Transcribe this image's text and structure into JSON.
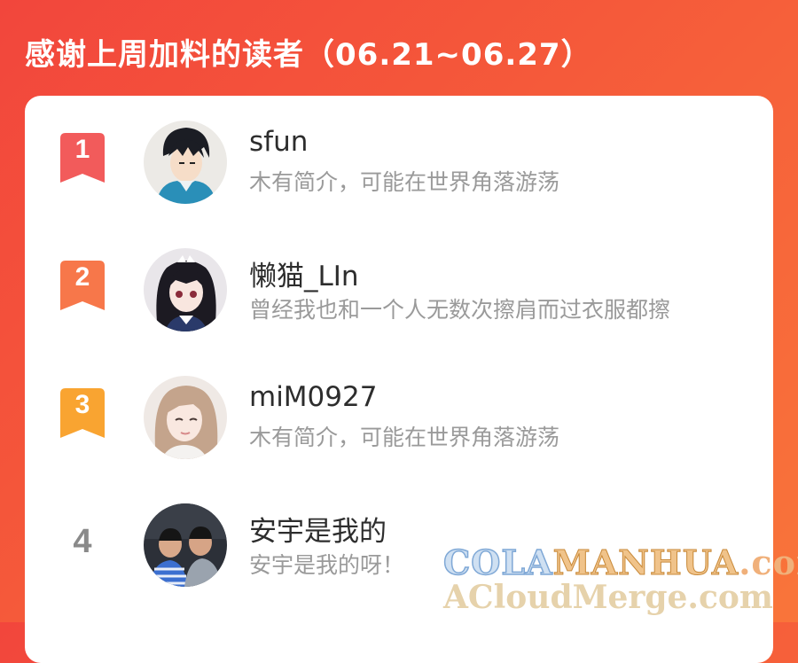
{
  "header": {
    "title": "感谢上周加料的读者（06.21~06.27）"
  },
  "readers": [
    {
      "rank": "1",
      "name": "sfun",
      "bio": "木有简介，可能在世界角落游荡",
      "badge_color": "#f25b5b"
    },
    {
      "rank": "2",
      "name": "懒猫_LIn",
      "bio": "曾经我也和一个人无数次擦肩而过衣服都擦",
      "badge_color": "#f7774a"
    },
    {
      "rank": "3",
      "name": "miM0927",
      "bio": "木有简介，可能在世界角落游荡",
      "badge_color": "#f9a431"
    },
    {
      "rank": "4",
      "name": "安宇是我的",
      "bio": "安宇是我的呀！"
    }
  ],
  "watermark": {
    "part1": "COLA",
    "part2": "MANHUA",
    "part3": ".com",
    "line2": "ACloudMerge.com"
  },
  "colors": {
    "background_start": "#f2463c",
    "background_end": "#f9753a",
    "card": "#ffffff",
    "name_text": "#2d2d2d",
    "bio_text": "#9a9a9a"
  }
}
